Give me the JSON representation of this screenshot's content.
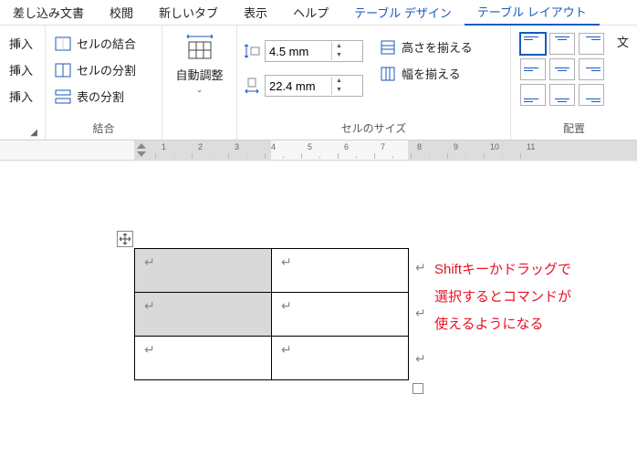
{
  "menubar": {
    "items": [
      {
        "label": "差し込み文書"
      },
      {
        "label": "校閲"
      },
      {
        "label": "新しいタブ"
      },
      {
        "label": "表示"
      },
      {
        "label": "ヘルプ"
      },
      {
        "label": "テーブル デザイン",
        "ctx": true
      },
      {
        "label": "テーブル レイアウト",
        "ctx": true,
        "active": true
      }
    ]
  },
  "ribbon": {
    "insert": {
      "row_above": "挿入",
      "row_below": "挿入",
      "col": "挿入"
    },
    "merge": {
      "merge_cells": "セルの結合",
      "split_cells": "セルの分割",
      "split_table": "表の分割",
      "group_label": "結合"
    },
    "autofit": {
      "label": "自動調整"
    },
    "size": {
      "height": "4.5 mm",
      "width": "22.4 mm",
      "dist_rows": "高さを揃える",
      "dist_cols": "幅を揃える",
      "group_label": "セルのサイズ"
    },
    "align": {
      "text_dir": "文",
      "group_label": "配置"
    }
  },
  "table": {
    "cell_mark": "↵"
  },
  "annotation": {
    "l1": "Shiftキーかドラッグで",
    "l2": "選択するとコマンドが",
    "l3": "使えるようになる"
  }
}
